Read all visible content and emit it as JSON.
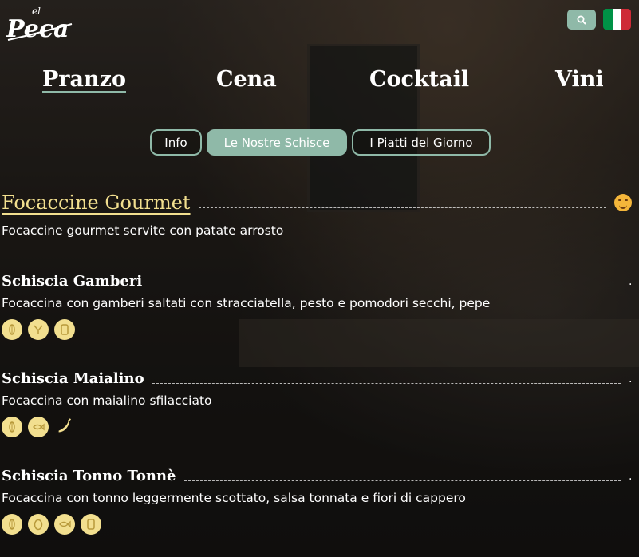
{
  "brand": {
    "logo_text_small": "el",
    "logo_text": "Peca"
  },
  "nav": {
    "items": [
      {
        "label": "Pranzo",
        "active": true
      },
      {
        "label": "Cena",
        "active": false
      },
      {
        "label": "Cocktail",
        "active": false
      },
      {
        "label": "Vini",
        "active": false
      }
    ]
  },
  "subnav": {
    "items": [
      {
        "label": "Info",
        "active": false
      },
      {
        "label": "Le Nostre Schisce",
        "active": true
      },
      {
        "label": "I Piatti del Giorno",
        "active": false
      }
    ]
  },
  "language": {
    "flag_colors": [
      "#009246",
      "#ffffff",
      "#ce2b37"
    ]
  },
  "colors": {
    "accent": "#8fb9a8",
    "gold": "#f2df8f"
  },
  "section": {
    "title": "Focaccine Gourmet",
    "description": "Focaccine gourmet servite con patate arrosto",
    "icon": "smiling-face-icon"
  },
  "items": [
    {
      "title": "Schiscia Gamberi",
      "price": ".",
      "description": "Focaccina con gamberi saltati con stracciatella, pesto e pomodori secchi, pepe",
      "allergens": [
        "gluten-icon",
        "shellfish-icon",
        "dairy-icon"
      ]
    },
    {
      "title": "Schiscia Maialino",
      "price": ".",
      "description": "Focaccina con maialino sfilacciato",
      "allergens": [
        "gluten-icon",
        "fish-icon",
        "spicy-icon"
      ]
    },
    {
      "title": "Schiscia Tonno Tonnè",
      "price": ".",
      "description": "Focaccina con tonno leggermente scottato, salsa tonnata e fiori di cappero",
      "allergens": [
        "gluten-icon",
        "egg-icon",
        "fish-icon",
        "dairy-icon"
      ]
    }
  ]
}
